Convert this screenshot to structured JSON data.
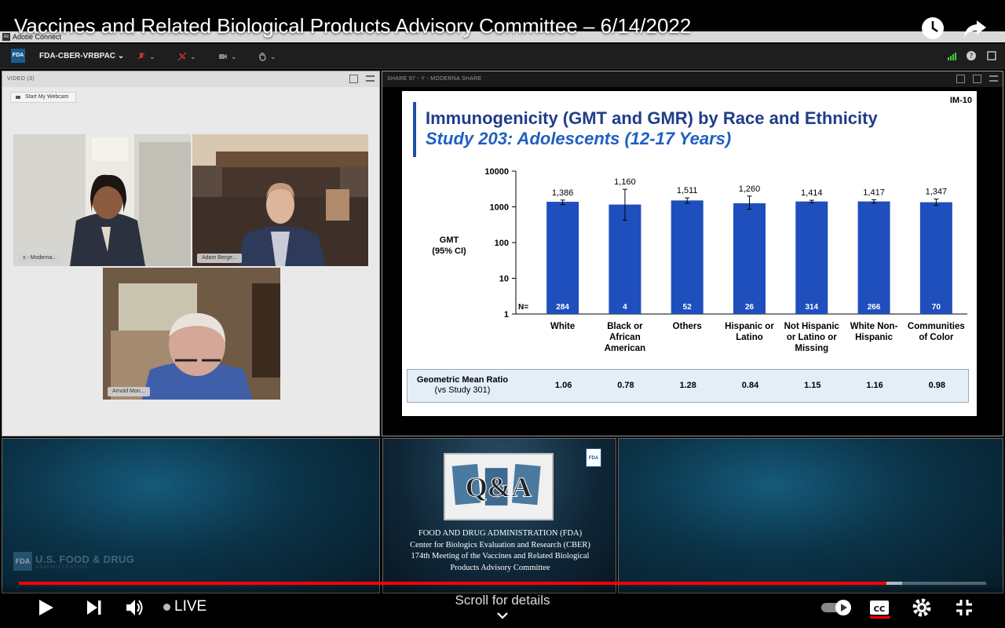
{
  "youtube": {
    "title": "Vaccines and Related Biological Products Advisory Committee – 6/14/2022",
    "live_label": "LIVE",
    "scroll_hint": "Scroll for details",
    "progress": {
      "played_fraction": 0.897,
      "buffered_fraction": 0.913
    },
    "icons": [
      "watch-later-icon",
      "share-icon",
      "play-icon",
      "next-icon",
      "volume-icon",
      "autoplay-toggle-icon",
      "captions-icon",
      "settings-icon",
      "fullscreen-icon"
    ]
  },
  "adobe_connect": {
    "window_title": "Adobe Connect",
    "logo_text": "Ac",
    "menubar": {
      "fda_badge": "FDA",
      "room_name": "FDA-CBER-VRBPAC"
    },
    "video_pod": {
      "header": "VIDEO (3)",
      "webcam_button": "Start My Webcam",
      "participants": [
        {
          "label": "x - Moderna..."
        },
        {
          "label": "Adam Berge..."
        },
        {
          "label": "Arnold Mon..."
        }
      ]
    },
    "share_pod": {
      "header": "SHARE 97  -  Y - MODERNA SHARE"
    }
  },
  "slide": {
    "number": "IM-10",
    "title": "Immunogenicity (GMT and GMR) by Race and Ethnicity",
    "subtitle": "Study 203: Adolescents (12-17 Years)",
    "gmr_label": "Geometric Mean Ratio",
    "gmr_sub": "(vs Study 301)"
  },
  "chart_data": {
    "type": "bar",
    "title": "",
    "ylabel": "GMT (95% CI)",
    "ylabel_lines": [
      "GMT",
      "(95% CI)"
    ],
    "yscale": "log",
    "ylim": [
      1,
      10000
    ],
    "yticks": [
      "10000",
      "1000",
      "100",
      "10",
      "1"
    ],
    "categories": [
      [
        "White"
      ],
      [
        "Black or",
        "African",
        "American"
      ],
      [
        "Others"
      ],
      [
        "Hispanic or",
        "Latino"
      ],
      [
        "Not Hispanic",
        "or Latino or",
        "Missing"
      ],
      [
        "White Non-",
        "Hispanic"
      ],
      [
        "Communities",
        "of Color"
      ]
    ],
    "values": [
      1386,
      1160,
      1511,
      1260,
      1414,
      1417,
      1347
    ],
    "value_labels": [
      "1,386",
      "1,160",
      "1,511",
      "1,260",
      "1,414",
      "1,417",
      "1,347"
    ],
    "ci_low": [
      1160,
      420,
      1250,
      860,
      1300,
      1270,
      1100
    ],
    "ci_high": [
      1550,
      3100,
      1780,
      2000,
      1530,
      1580,
      1650
    ],
    "n_label": "N=",
    "n": [
      "284",
      "4",
      "52",
      "26",
      "314",
      "266",
      "70"
    ],
    "gmr": [
      "1.06",
      "0.78",
      "1.28",
      "0.84",
      "1.15",
      "1.16",
      "0.98"
    ],
    "bar_color": "#1f4fbd"
  },
  "qa_pod": {
    "badge": "FDA",
    "lines": [
      "FOOD AND DRUG ADMINISTRATION (FDA)",
      "Center for Biologics Evaluation and Research (CBER)",
      "174th Meeting of the Vaccines and Related Biological",
      "Products Advisory Committee"
    ],
    "qa_text": "Q&A"
  },
  "fda_logo": {
    "mark": "FDA",
    "name": "U.S. FOOD & DRUG",
    "sub": "ADMINISTRATION"
  }
}
